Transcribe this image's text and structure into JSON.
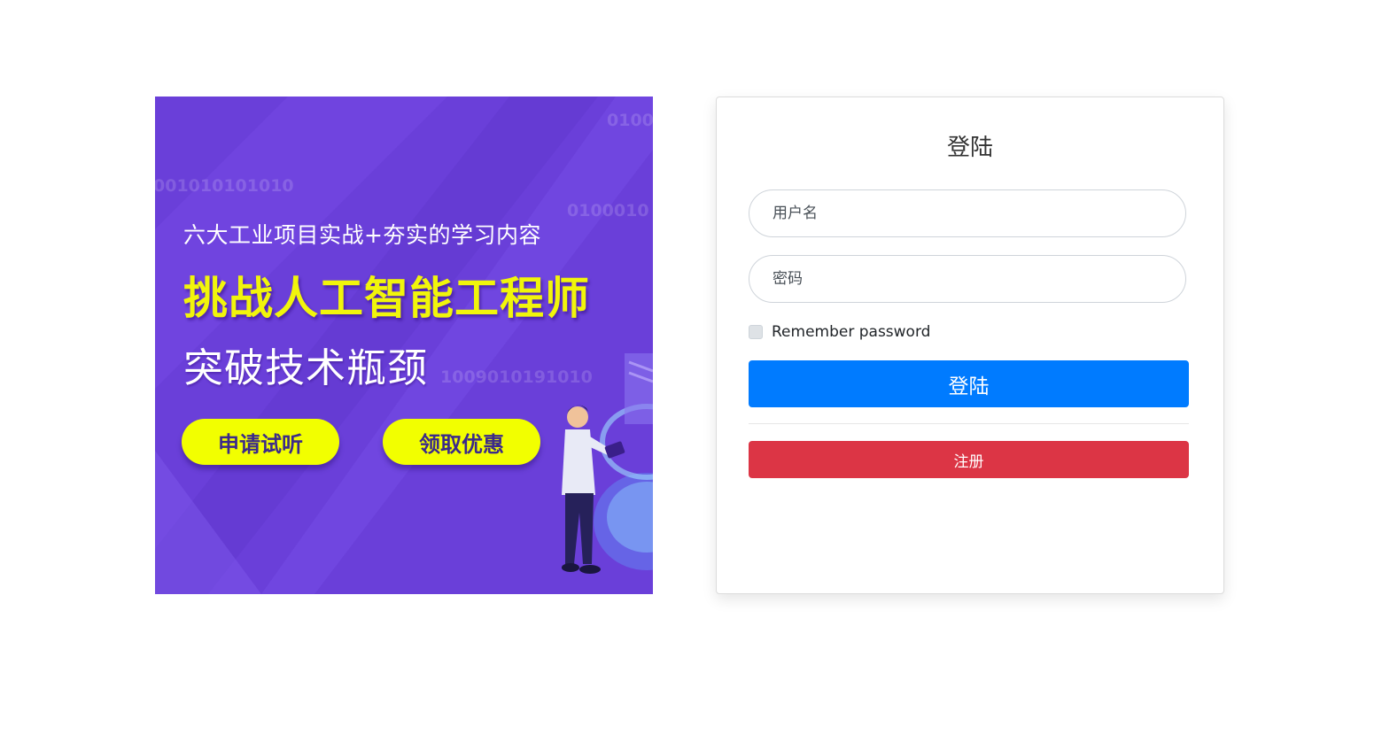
{
  "banner": {
    "subtitle": "六大工业项目实战+夯实的学习内容",
    "title": "挑战人工智能工程师",
    "title2": "突破技术瓶颈",
    "button_trial": "申请试听",
    "button_offer": "领取优惠",
    "binary": [
      "0100",
      "001010101010",
      "0100010",
      "1009010191010"
    ]
  },
  "login": {
    "title": "登陆",
    "username_placeholder": "用户名",
    "password_placeholder": "密码",
    "remember_label": "Remember password",
    "login_button": "登陆",
    "register_button": "注册"
  },
  "colors": {
    "banner_bg": "#6a3fd9",
    "banner_accent": "#f2ff00",
    "login_button": "#007bff",
    "register_button": "#dc3545"
  }
}
